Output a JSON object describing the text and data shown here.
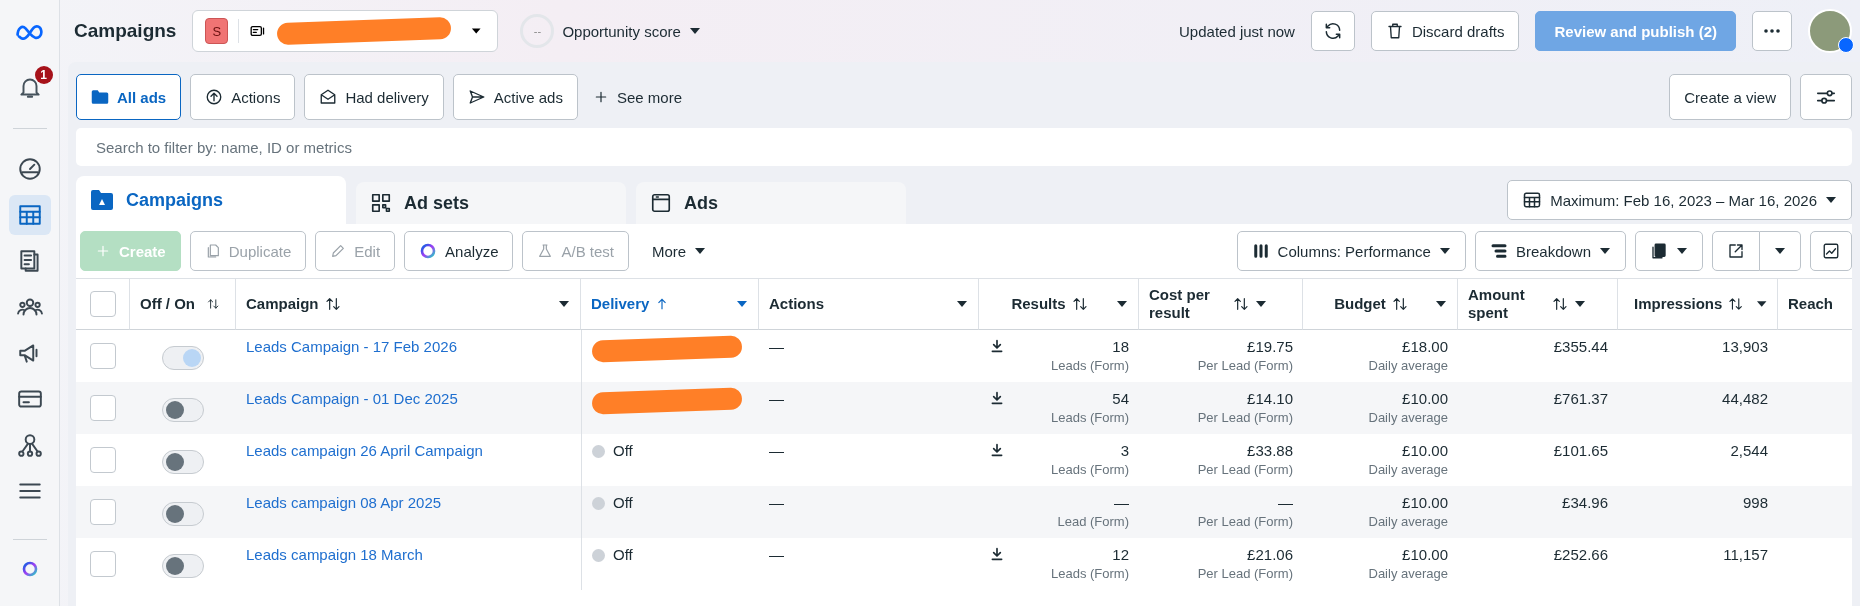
{
  "sidebar": {
    "notification_badge": "1",
    "items": [
      {
        "selected": false
      },
      {
        "selected": true
      },
      {
        "selected": false
      },
      {
        "selected": false
      },
      {
        "selected": false
      },
      {
        "selected": false
      },
      {
        "selected": false
      },
      {
        "selected": false
      }
    ]
  },
  "header": {
    "title": "Campaigns",
    "account_initial": "S",
    "account_name": {
      "kind": "redacted"
    },
    "opportunity_score": "--",
    "opportunity_label": "Opportunity score",
    "updated": "Updated just now",
    "discard": "Discard drafts",
    "publish": {
      "label": "Review and publish (2)",
      "disabled": true
    }
  },
  "filters": [
    {
      "label": "All ads",
      "selected": true
    },
    {
      "label": "Actions",
      "selected": false
    },
    {
      "label": "Had delivery",
      "selected": false
    },
    {
      "label": "Active ads",
      "selected": false
    }
  ],
  "see_more": "See more",
  "create_view": "Create a view",
  "search": {
    "placeholder": "Search to filter by: name, ID or metrics"
  },
  "tabs": [
    {
      "label": "Campaigns",
      "selected": true
    },
    {
      "label": "Ad sets",
      "selected": false
    },
    {
      "label": "Ads",
      "selected": false
    }
  ],
  "date_range": "Maximum: Feb 16, 2023 – Mar 16, 2026",
  "toolbar": {
    "buttons": [
      {
        "label": "Create",
        "disabled": true
      },
      {
        "label": "Duplicate",
        "disabled": true
      },
      {
        "label": "Edit",
        "disabled": true
      },
      {
        "label": "Analyze",
        "disabled": false
      },
      {
        "label": "A/B test",
        "disabled": true
      }
    ],
    "more": "More",
    "columns": "Columns: Performance",
    "breakdown": "Breakdown"
  },
  "table": {
    "select_all_checked": false,
    "columns": [
      {
        "label": "Off / On",
        "sortable": true,
        "menu": false,
        "sorted": false
      },
      {
        "label": "Campaign",
        "sortable": true,
        "menu": true,
        "sorted": false
      },
      {
        "label": "Delivery",
        "sortable": true,
        "menu": true,
        "sorted": true
      },
      {
        "label": "Actions",
        "sortable": false,
        "menu": true,
        "sorted": false
      },
      {
        "label": "Results",
        "sortable": true,
        "menu": true,
        "sorted": false
      },
      {
        "label": "Cost per result",
        "sortable": true,
        "menu": true,
        "sorted": false
      },
      {
        "label": "Budget",
        "sortable": true,
        "menu": true,
        "sorted": false
      },
      {
        "label": "Amount spent",
        "sortable": true,
        "menu": true,
        "sorted": false
      },
      {
        "label": "Impressions",
        "sortable": true,
        "menu": true,
        "sorted": false
      },
      {
        "label": "Reach",
        "sortable": false,
        "menu": false,
        "sorted": false
      }
    ],
    "rows": [
      {
        "checked": false,
        "on": true,
        "campaign": "Leads Campaign - 17 Feb 2026",
        "delivery": {
          "kind": "redacted"
        },
        "actions": "—",
        "results": {
          "value": "18",
          "label": "Leads (Form)",
          "download": true
        },
        "cost": {
          "value": "£19.75",
          "label": "Per Lead (Form)"
        },
        "budget": {
          "value": "£18.00",
          "label": "Daily average"
        },
        "spent": "£355.44",
        "impressions": "13,903"
      },
      {
        "checked": false,
        "on": false,
        "campaign": "Leads Campaign - 01 Dec 2025",
        "delivery": {
          "kind": "redacted"
        },
        "actions": "—",
        "results": {
          "value": "54",
          "label": "Leads (Form)",
          "download": true
        },
        "cost": {
          "value": "£14.10",
          "label": "Per Lead (Form)"
        },
        "budget": {
          "value": "£10.00",
          "label": "Daily average"
        },
        "spent": "£761.37",
        "impressions": "44,482"
      },
      {
        "checked": false,
        "on": false,
        "campaign": "Leads campaign 26 April Campaign",
        "delivery": {
          "kind": "status",
          "text": "Off"
        },
        "actions": "—",
        "results": {
          "value": "3",
          "label": "Leads (Form)",
          "download": true
        },
        "cost": {
          "value": "£33.88",
          "label": "Per Lead (Form)"
        },
        "budget": {
          "value": "£10.00",
          "label": "Daily average"
        },
        "spent": "£101.65",
        "impressions": "2,544"
      },
      {
        "checked": false,
        "on": false,
        "campaign": "Leads campaign 08 Apr 2025",
        "delivery": {
          "kind": "status",
          "text": "Off"
        },
        "actions": "—",
        "results": {
          "value": "—",
          "label": "Lead (Form)",
          "download": false
        },
        "cost": {
          "value": "—",
          "label": "Per Lead (Form)"
        },
        "budget": {
          "value": "£10.00",
          "label": "Daily average"
        },
        "spent": "£34.96",
        "impressions": "998"
      },
      {
        "checked": false,
        "on": false,
        "campaign": "Leads campaign 18 March",
        "delivery": {
          "kind": "status",
          "text": "Off"
        },
        "actions": "—",
        "results": {
          "value": "12",
          "label": "Leads (Form)",
          "download": true
        },
        "cost": {
          "value": "£21.06",
          "label": "Per Lead (Form)"
        },
        "budget": {
          "value": "£10.00",
          "label": "Daily average"
        },
        "spent": "£252.66",
        "impressions": "11,157"
      }
    ]
  }
}
